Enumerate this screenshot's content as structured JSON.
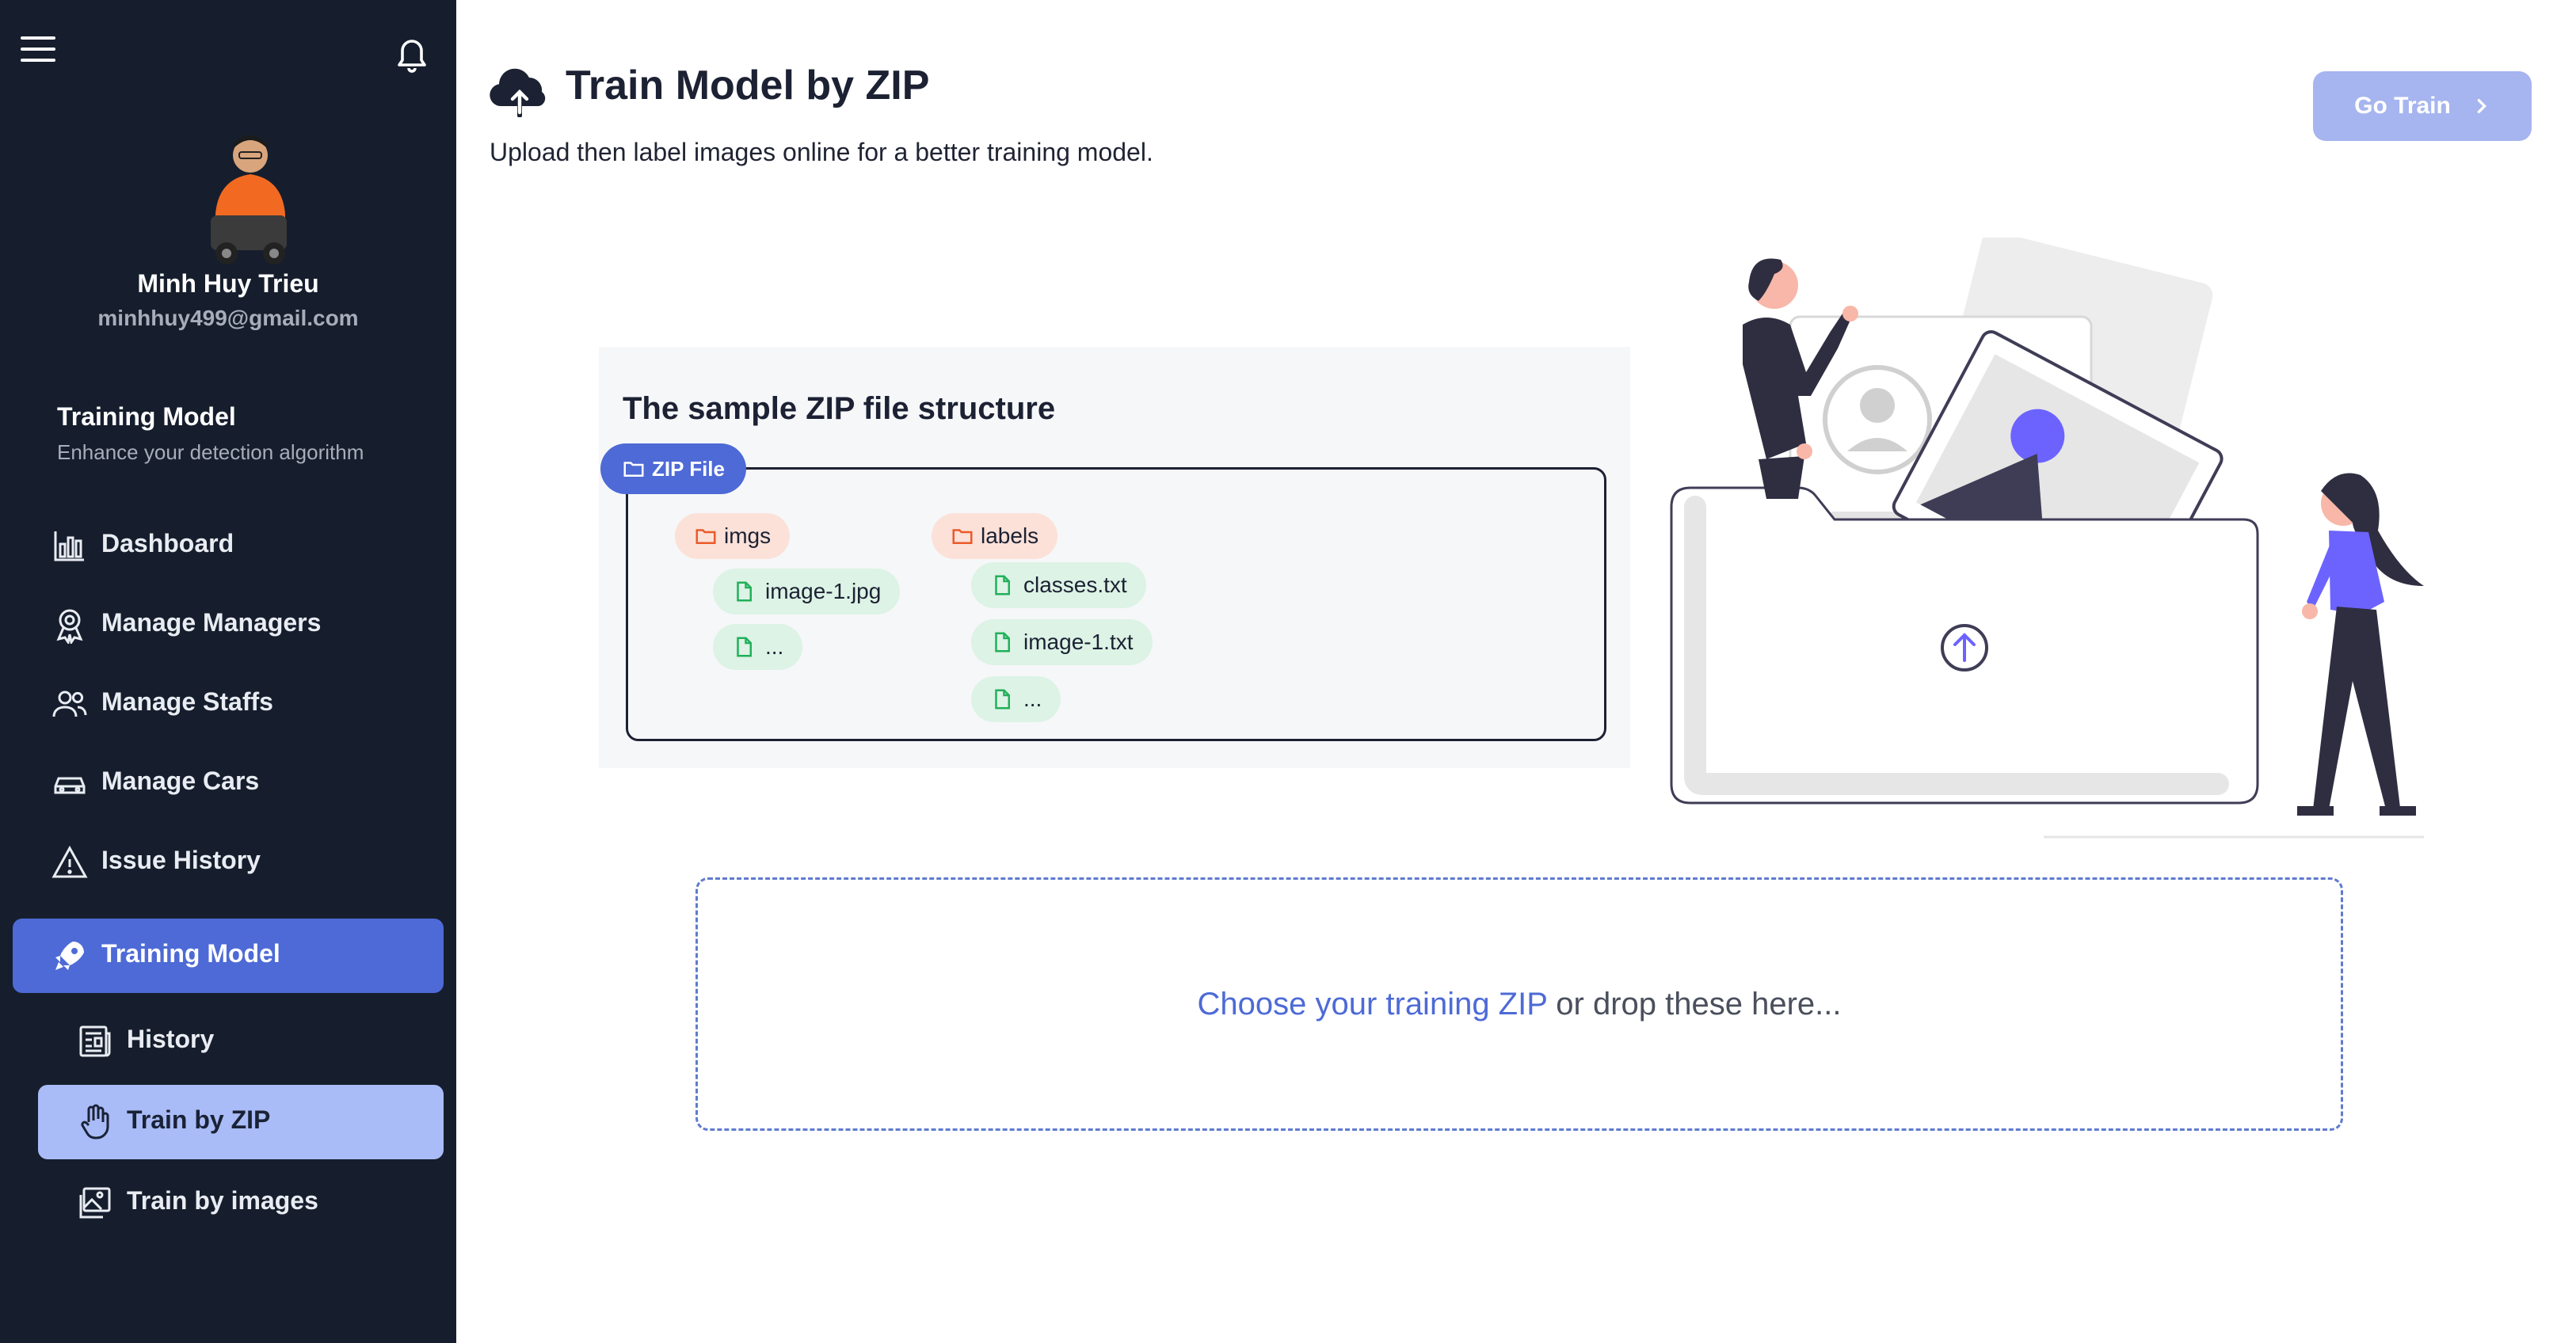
{
  "sidebar": {
    "user": {
      "name": "Minh Huy Trieu",
      "email": "minhhuy499@gmail.com"
    },
    "section": {
      "title": "Training Model",
      "subtitle": "Enhance your detection algorithm"
    },
    "nav": [
      {
        "label": "Dashboard",
        "icon": "bar-chart-icon"
      },
      {
        "label": "Manage Managers",
        "icon": "award-icon"
      },
      {
        "label": "Manage Staffs",
        "icon": "users-icon"
      },
      {
        "label": "Manage Cars",
        "icon": "car-icon"
      },
      {
        "label": "Issue History",
        "icon": "warning-icon"
      },
      {
        "label": "Training Model",
        "icon": "rocket-icon",
        "active": true
      }
    ],
    "subnav": [
      {
        "label": "History",
        "icon": "newspaper-icon"
      },
      {
        "label": "Train by ZIP",
        "icon": "hand-pointer-icon",
        "selected": true
      },
      {
        "label": "Train by images",
        "icon": "images-icon"
      }
    ]
  },
  "header": {
    "title": "Train Model by ZIP",
    "subtitle": "Upload then label images online for a better training model.",
    "go_train_label": "Go Train"
  },
  "sample": {
    "title": "The sample ZIP file structure",
    "zip_label": "ZIP File",
    "imgs_folder": "imgs",
    "imgs_files": [
      "image-1.jpg",
      "..."
    ],
    "labels_folder": "labels",
    "labels_files": [
      "classes.txt",
      "image-1.txt",
      "..."
    ]
  },
  "dropzone": {
    "link_text": "Choose your training ZIP",
    "rest_text": " or drop these here..."
  },
  "colors": {
    "sidebar_bg": "#161e2d",
    "accent": "#4d6ad6",
    "selected_bg": "#a9bcf7",
    "go_train_bg": "#a6b5ef",
    "folder_pill": "#fbe1d8",
    "file_pill": "#dcf3e5",
    "illustration_purple": "#6c63ff"
  }
}
